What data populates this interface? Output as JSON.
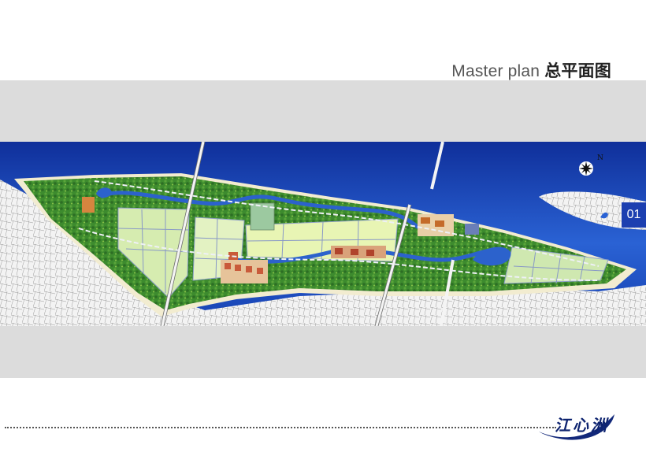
{
  "header": {
    "title_en": "Master plan",
    "title_cn": "总平面图"
  },
  "map": {
    "north_label": "N",
    "page_number": "01",
    "colors": {
      "river": "#1f55c8",
      "river_dark": "#0c2a8a",
      "bank": "#f0ead2",
      "green": "#3c8a2c",
      "field": "#dcefb8",
      "road": "#7a8ab8",
      "band": "#dcdcdc"
    }
  },
  "footer": {
    "logo_text": "江心洲",
    "icons": [
      "north-compass-icon",
      "logo-leaf-icon"
    ]
  }
}
